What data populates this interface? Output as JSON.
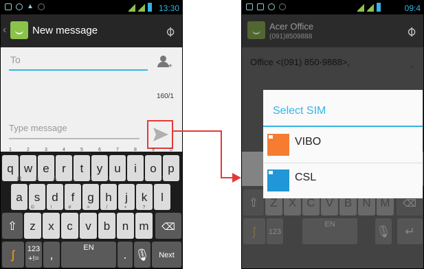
{
  "left_phone": {
    "status_time": "13:30",
    "title": "New message",
    "to_placeholder": "To",
    "char_count": "160/1",
    "message_placeholder": "Type message",
    "keyboard": {
      "row1": [
        {
          "k": "q",
          "a": "1"
        },
        {
          "k": "w",
          "a": "2"
        },
        {
          "k": "e",
          "a": "3"
        },
        {
          "k": "r",
          "a": "4"
        },
        {
          "k": "t",
          "a": "5"
        },
        {
          "k": "y",
          "a": "6"
        },
        {
          "k": "u",
          "a": "7"
        },
        {
          "k": "i",
          "a": "8"
        },
        {
          "k": "o",
          "a": "9"
        },
        {
          "k": "p",
          "a": "0"
        }
      ],
      "row2": [
        {
          "k": "a",
          "a": "@"
        },
        {
          "k": "s",
          "a": "$"
        },
        {
          "k": "d",
          "a": "&"
        },
        {
          "k": "f",
          "a": "_"
        },
        {
          "k": "g",
          "a": "("
        },
        {
          "k": "h",
          "a": ")"
        },
        {
          "k": "j",
          "a": ":"
        },
        {
          "k": "k",
          "a": ";"
        },
        {
          "k": "l",
          "a": "\""
        }
      ],
      "row3": [
        {
          "k": "z",
          "a": "©"
        },
        {
          "k": "x",
          "a": "!"
        },
        {
          "k": "c",
          "a": "#"
        },
        {
          "k": "v",
          "a": "="
        },
        {
          "k": "b",
          "a": "/"
        },
        {
          "k": "n",
          "a": "+"
        },
        {
          "k": "m",
          "a": "?"
        }
      ],
      "symbols_key": "123\n+!=",
      "comma_key": ",",
      "space_label": "EN",
      "period_key": ".",
      "next_key": "Next"
    }
  },
  "right_phone": {
    "status_time": "09:4",
    "contact_name": "Acer Office",
    "contact_number": "(091)8509888",
    "recipient": "Office <(091) 850-9888>,",
    "dialog_title": "Select SIM",
    "sims": [
      {
        "label": "VIBO",
        "color": "#f57c31"
      },
      {
        "label": "CSL",
        "color": "#2196d8"
      }
    ],
    "keyboard": {
      "row1": [
        "Z",
        "X",
        "C",
        "V",
        "B",
        "N",
        "M"
      ],
      "space_label": "EN",
      "symbols_key": "123"
    }
  },
  "colors": {
    "accent": "#33b5e5",
    "highlight": "#e53935"
  }
}
